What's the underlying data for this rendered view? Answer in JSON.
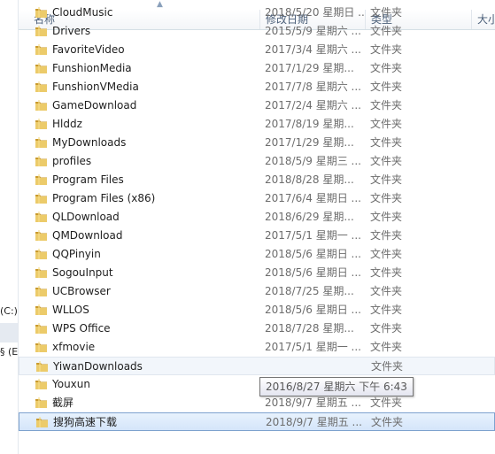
{
  "columns": {
    "name": "名称",
    "date": "修改日期",
    "type": "类型",
    "size": "大小"
  },
  "left_pane": {
    "drive_c": "(C:)",
    "drive_e": "§ (E"
  },
  "files": [
    {
      "name": "CloudMusic",
      "date": "2018/5/20 星期日 ...",
      "type": "文件夹"
    },
    {
      "name": "Drivers",
      "date": "2015/5/9 星期六 ...",
      "type": "文件夹"
    },
    {
      "name": "FavoriteVideo",
      "date": "2017/3/4 星期六 ...",
      "type": "文件夹"
    },
    {
      "name": "FunshionMedia",
      "date": "2017/1/29 星期...",
      "type": "文件夹"
    },
    {
      "name": "FunshionVMedia",
      "date": "2017/7/8 星期六 ...",
      "type": "文件夹"
    },
    {
      "name": "GameDownload",
      "date": "2017/2/4 星期六 ...",
      "type": "文件夹"
    },
    {
      "name": "Hlddz",
      "date": "2017/8/19 星期...",
      "type": "文件夹"
    },
    {
      "name": "MyDownloads",
      "date": "2017/1/29 星期...",
      "type": "文件夹"
    },
    {
      "name": "profiles",
      "date": "2018/5/9 星期三 ...",
      "type": "文件夹"
    },
    {
      "name": "Program Files",
      "date": "2018/8/28 星期...",
      "type": "文件夹"
    },
    {
      "name": "Program Files (x86)",
      "date": "2017/6/4 星期日 ...",
      "type": "文件夹"
    },
    {
      "name": "QLDownload",
      "date": "2018/6/29 星期...",
      "type": "文件夹"
    },
    {
      "name": "QMDownload",
      "date": "2017/5/1 星期一 ...",
      "type": "文件夹"
    },
    {
      "name": "QQPinyin",
      "date": "2018/5/6 星期日 ...",
      "type": "文件夹"
    },
    {
      "name": "SogouInput",
      "date": "2018/5/6 星期日 ...",
      "type": "文件夹"
    },
    {
      "name": "UCBrowser",
      "date": "2018/7/25 星期...",
      "type": "文件夹"
    },
    {
      "name": "WLLOS",
      "date": "2018/5/6 星期日 ...",
      "type": "文件夹"
    },
    {
      "name": "WPS Office",
      "date": "2018/7/28 星期...",
      "type": "文件夹"
    },
    {
      "name": "xfmovie",
      "date": "2017/5/1 星期一 ...",
      "type": "文件夹"
    },
    {
      "name": "YiwanDownloads",
      "date": "",
      "type": "文件夹"
    },
    {
      "name": "Youxun",
      "date": "2017/1/29 星期...",
      "type": "文件夹"
    },
    {
      "name": "截屏",
      "date": "2018/9/7 星期五 ...",
      "type": "文件夹"
    },
    {
      "name": "搜狗高速下载",
      "date": "2018/9/7 星期五 ...",
      "type": "文件夹"
    }
  ],
  "tooltip": "2016/8/27 星期六 下午 6:43",
  "colors": {
    "folder": "#e9c35a",
    "folder_dark": "#c99a2e",
    "selection": "#d4e5fa"
  },
  "icons": {
    "folder": "folder-icon"
  }
}
